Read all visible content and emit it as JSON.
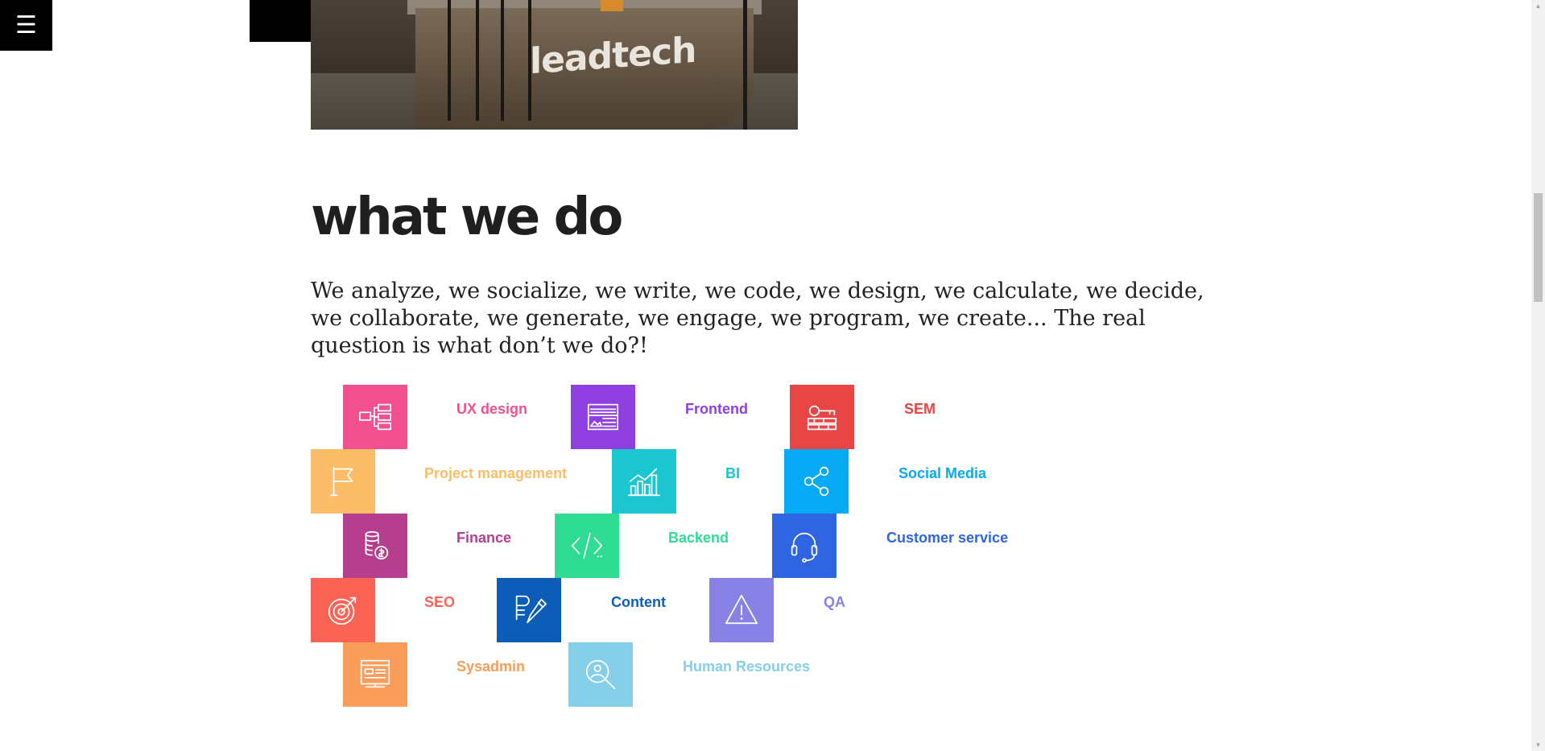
{
  "menu": {
    "icon": "hamburger-icon",
    "glyph": "☰"
  },
  "hero": {
    "logo_text": "leadtech",
    "alt": "leadtech reception desk photo"
  },
  "section": {
    "heading": "what we do",
    "intro": "We analyze, we socialize, we write, we code, we design, we calculate, we decide, we collaborate, we generate, we engage, we program, we create... The real question is what don’t we do?!"
  },
  "services": [
    {
      "label": "UX design",
      "color": "#f2508e",
      "icon": "flowchart-icon"
    },
    {
      "label": "Frontend",
      "color": "#8f3fe0",
      "icon": "layout-icon"
    },
    {
      "label": "SEM",
      "color": "#e84545",
      "icon": "key-icon"
    },
    {
      "label": "Project management",
      "color": "#fbbd67",
      "icon": "flag-icon"
    },
    {
      "label": "BI",
      "color": "#1cc6d0",
      "icon": "bar-chart-icon"
    },
    {
      "label": "Social Media",
      "color": "#06a9f4",
      "icon": "share-icon"
    },
    {
      "label": "Finance",
      "color": "#b63e8f",
      "icon": "coins-icon"
    },
    {
      "label": "Backend",
      "color": "#2fdc94",
      "icon": "code-icon"
    },
    {
      "label": "Customer service",
      "color": "#2f65e0",
      "icon": "headset-icon"
    },
    {
      "label": "SEO",
      "color": "#fb6455",
      "icon": "target-icon"
    },
    {
      "label": "Content",
      "color": "#0c5db8",
      "icon": "pencil-icon"
    },
    {
      "label": "QA",
      "color": "#8882e6",
      "icon": "warning-icon"
    },
    {
      "label": "Sysadmin",
      "color": "#fa9d5a",
      "icon": "server-icon"
    },
    {
      "label": "Human Resources",
      "color": "#85cfe9",
      "icon": "search-person-icon"
    }
  ],
  "scrollbar": {
    "up": "▲",
    "down": "▼"
  }
}
